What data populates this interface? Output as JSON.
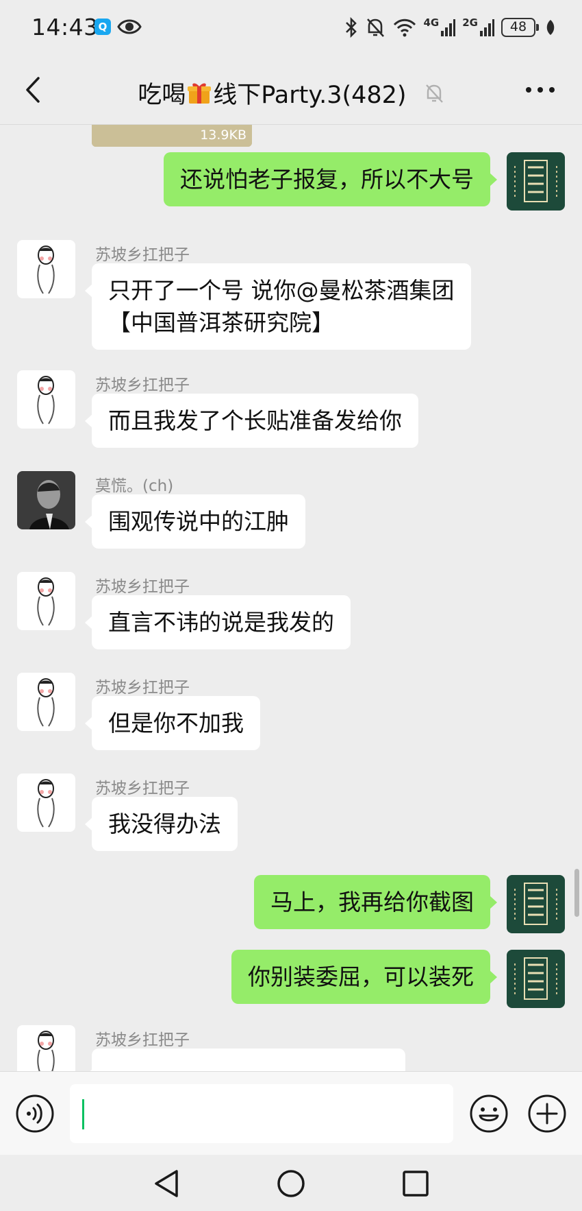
{
  "status_bar": {
    "time": "14:43",
    "network_1": "4G",
    "network_2": "2G",
    "battery": "48"
  },
  "header": {
    "title_prefix": "吃喝",
    "title_icon": "gift-icon",
    "title_suffix": "线下Party.3(482)",
    "muted": true
  },
  "messages": [
    {
      "type": "image",
      "direction": "in",
      "size_label": "13.9KB"
    },
    {
      "type": "text",
      "direction": "out",
      "text": "还说怕老子报复，所以不大号"
    },
    {
      "type": "text",
      "direction": "in",
      "sender": "苏坡乡扛把子",
      "lines": [
        "只开了一个号 说你@曼松茶酒集团",
        "【中国普洱茶研究院】"
      ]
    },
    {
      "type": "text",
      "direction": "in",
      "sender": "苏坡乡扛把子",
      "text": "而且我发了个长贴准备发给你"
    },
    {
      "type": "text",
      "direction": "in",
      "sender": "莫慌。(ch)",
      "text": "围观传说中的江肿"
    },
    {
      "type": "text",
      "direction": "in",
      "sender": "苏坡乡扛把子",
      "text": "直言不讳的说是我发的"
    },
    {
      "type": "text",
      "direction": "in",
      "sender": "苏坡乡扛把子",
      "text": "但是你不加我"
    },
    {
      "type": "text",
      "direction": "in",
      "sender": "苏坡乡扛把子",
      "text": "我没得办法"
    },
    {
      "type": "text",
      "direction": "out",
      "text": "马上，我再给你截图"
    },
    {
      "type": "text",
      "direction": "out",
      "text": "你别装委屈，可以装死"
    },
    {
      "type": "text",
      "direction": "in",
      "sender": "苏坡乡扛把子",
      "text": ""
    }
  ],
  "input": {
    "value": "",
    "placeholder": ""
  },
  "colors": {
    "background": "#ededed",
    "outgoing_bubble": "#95ec69",
    "incoming_bubble": "#ffffff",
    "caret": "#07c160",
    "my_avatar": "#1d4a3a"
  }
}
